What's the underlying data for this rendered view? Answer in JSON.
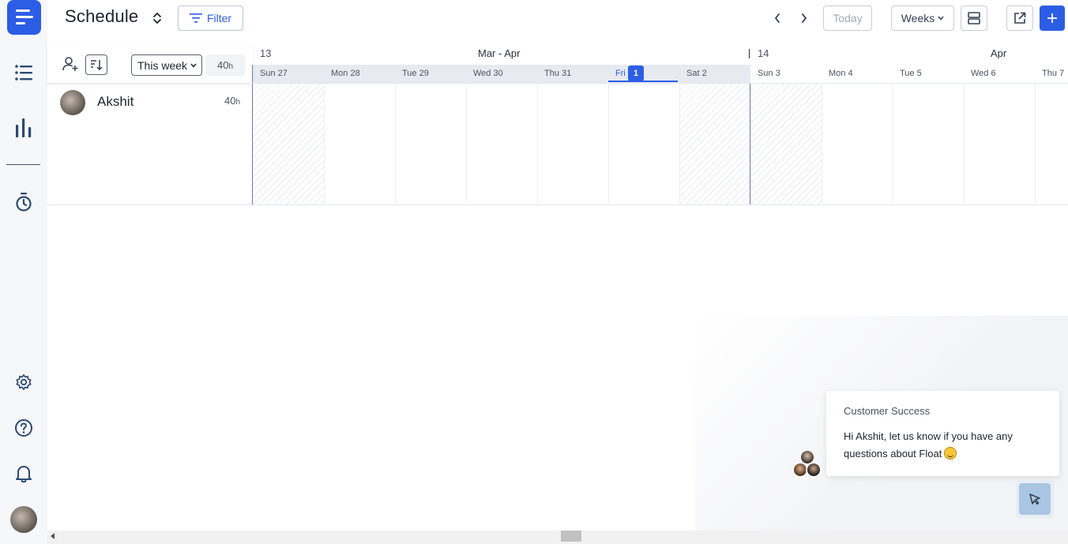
{
  "header": {
    "title": "Schedule",
    "filter_label": "Filter",
    "today_label": "Today",
    "view_label": "Weeks"
  },
  "people_panel": {
    "range_select": "This week",
    "total_hours": "40",
    "hours_unit": "h"
  },
  "timeline": {
    "weeks": [
      {
        "number": "13",
        "month": "Mar - Apr"
      },
      {
        "number": "14",
        "month": "Apr"
      }
    ],
    "days": [
      {
        "label": "Sun 27",
        "weekend": true
      },
      {
        "label": "Mon 28",
        "weekend": false
      },
      {
        "label": "Tue 29",
        "weekend": false
      },
      {
        "label": "Wed 30",
        "weekend": false
      },
      {
        "label": "Thu 31",
        "weekend": false
      },
      {
        "label": "Fri",
        "weekend": false,
        "today": true,
        "badge": "1"
      },
      {
        "label": "Sat 2",
        "weekend": true
      },
      {
        "label": "Sun 3",
        "weekend": true
      },
      {
        "label": "Mon 4",
        "weekend": false
      },
      {
        "label": "Tue 5",
        "weekend": false
      },
      {
        "label": "Wed 6",
        "weekend": false
      },
      {
        "label": "Thu 7",
        "weekend": false
      }
    ]
  },
  "people": [
    {
      "name": "Akshit",
      "hours": "40",
      "unit": "h"
    }
  ],
  "chat": {
    "from": "Customer Success",
    "message": "Hi Akshit, let us know if you have any questions about Float"
  },
  "icons": {
    "logo": "float-logo-icon",
    "list": "list-icon",
    "report": "bar-chart-icon",
    "timer": "timer-icon",
    "settings": "gear-icon",
    "help": "help-icon",
    "notifications": "bell-icon"
  },
  "colors": {
    "accent": "#2c5de5",
    "rail": "#f6f7f9",
    "weekend_hatch": "#e9ebef"
  }
}
